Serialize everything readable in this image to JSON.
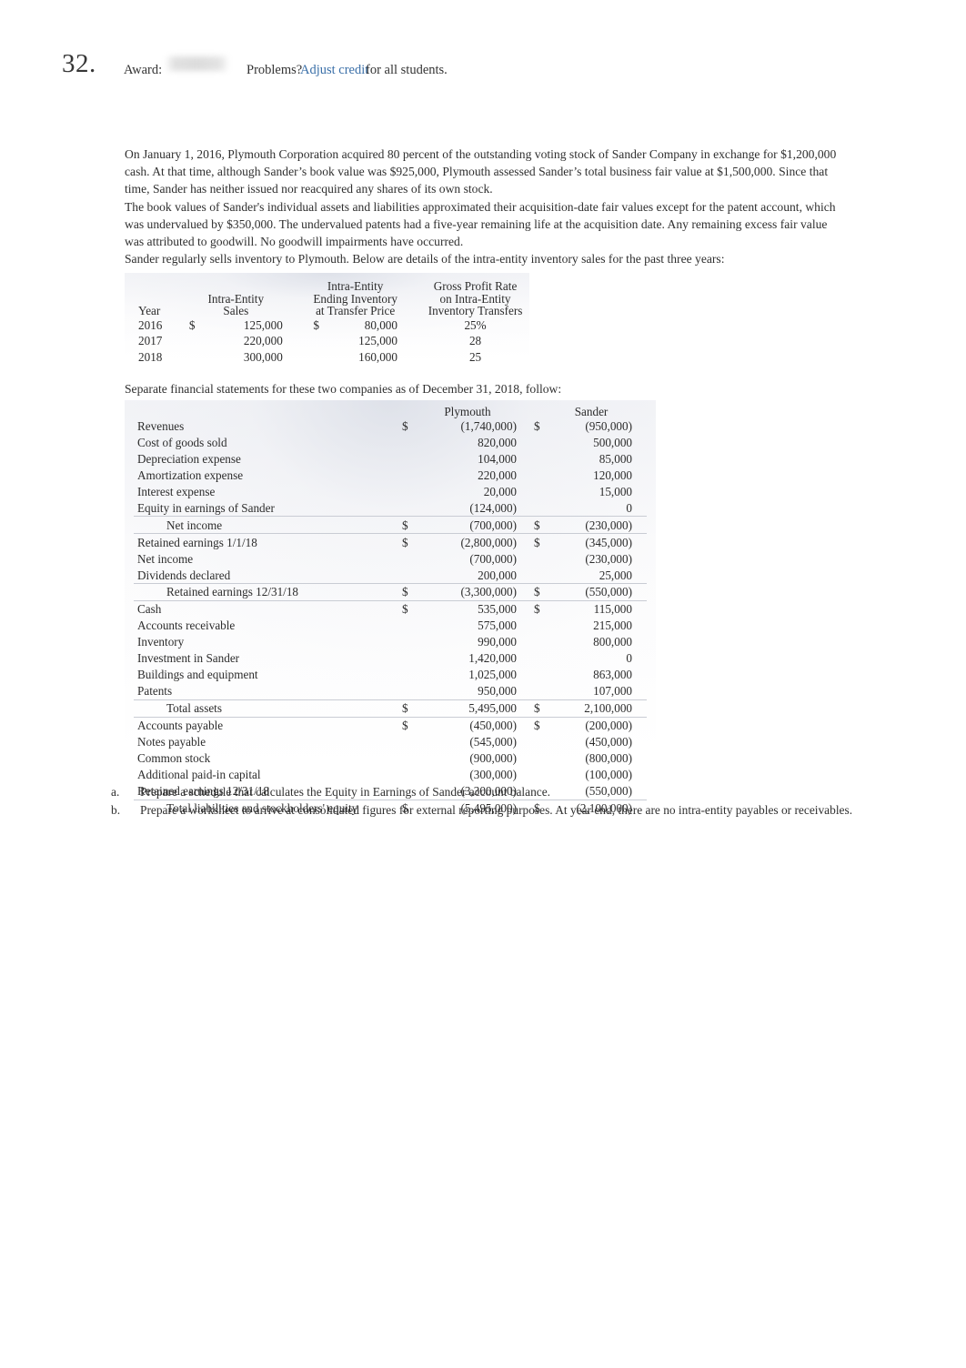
{
  "header": {
    "question_number": "32.",
    "award_label": "Award:",
    "award_value_hidden": "",
    "problems_label": "Problems?",
    "adjust_credit_link": "Adjust credit",
    "for_all_students": "for all students."
  },
  "body": {
    "paragraph_1": "On January 1, 2016, Plymouth Corporation acquired 80 percent of the outstanding voting stock of Sander Company in exchange for $1,200,000 cash. At that time, although Sander’s book value was $925,000, Plymouth assessed Sander’s total business fair value at $1,500,000. Since that time, Sander has neither issued nor reacquired any shares of its own stock.",
    "paragraph_2": "The book values of Sander's individual assets and liabilities approximated their acquisition-date fair values except for the patent account, which was undervalued by $350,000. The undervalued patents had a five-year remaining life at the acquisition date. Any remaining excess fair value was attributed to goodwill. No goodwill impairments have occurred.",
    "paragraph_3": "Sander regularly sells inventory to Plymouth. Below are details of the intra-entity inventory sales for the past three years:",
    "paragraph_4": "Separate financial statements for these two companies as of December 31, 2018, follow:"
  },
  "intra_entity_table": {
    "headers": {
      "col1_line3": "Year",
      "col2_line2": "Intra-Entity",
      "col2_line3": "Sales",
      "col3_line1": "Intra-Entity",
      "col3_line2": "Ending Inventory",
      "col3_line3": "at Transfer Price",
      "col4_line1": "Gross Profit Rate",
      "col4_line2": "on Intra-Entity",
      "col4_line3": "Inventory Transfers"
    },
    "rows": [
      {
        "year": "2016",
        "sales_cur": "$",
        "sales": "125,000",
        "ending_cur": "$",
        "ending": "80,000",
        "rate": "25%"
      },
      {
        "year": "2017",
        "sales_cur": "",
        "sales": "220,000",
        "ending_cur": "",
        "ending": "125,000",
        "rate": "28"
      },
      {
        "year": "2018",
        "sales_cur": "",
        "sales": "300,000",
        "ending_cur": "",
        "ending": "160,000",
        "rate": "25"
      }
    ]
  },
  "statements_table": {
    "col_header_plymouth": "Plymouth",
    "col_header_sander": "Sander",
    "rows": [
      {
        "label": "Revenues",
        "indent": false,
        "rule": false,
        "gap": false,
        "p_cur": "$",
        "p_amt": "(1,740,000)",
        "s_cur": "$",
        "s_amt": "(950,000)"
      },
      {
        "label": "Cost of goods sold",
        "indent": false,
        "rule": false,
        "gap": false,
        "p_cur": "",
        "p_amt": "820,000",
        "s_cur": "",
        "s_amt": "500,000"
      },
      {
        "label": "Depreciation expense",
        "indent": false,
        "rule": false,
        "gap": false,
        "p_cur": "",
        "p_amt": "104,000",
        "s_cur": "",
        "s_amt": "85,000"
      },
      {
        "label": "Amortization expense",
        "indent": false,
        "rule": false,
        "gap": false,
        "p_cur": "",
        "p_amt": "220,000",
        "s_cur": "",
        "s_amt": "120,000"
      },
      {
        "label": "Interest expense",
        "indent": false,
        "rule": false,
        "gap": false,
        "p_cur": "",
        "p_amt": "20,000",
        "s_cur": "",
        "s_amt": "15,000"
      },
      {
        "label": "Equity in earnings of Sander",
        "indent": false,
        "rule": false,
        "gap": false,
        "p_cur": "",
        "p_amt": "(124,000)",
        "s_cur": "",
        "s_amt": "0"
      },
      {
        "label": "Net income",
        "indent": true,
        "rule": true,
        "gap": false,
        "p_cur": "$",
        "p_amt": "(700,000)",
        "s_cur": "$",
        "s_amt": "(230,000)"
      },
      {
        "label": "Retained earnings 1/1/18",
        "indent": false,
        "rule": true,
        "gap": true,
        "p_cur": "$",
        "p_amt": "(2,800,000)",
        "s_cur": "$",
        "s_amt": "(345,000)"
      },
      {
        "label": "Net income",
        "indent": false,
        "rule": false,
        "gap": false,
        "p_cur": "",
        "p_amt": "(700,000)",
        "s_cur": "",
        "s_amt": "(230,000)"
      },
      {
        "label": "Dividends declared",
        "indent": false,
        "rule": false,
        "gap": false,
        "p_cur": "",
        "p_amt": "200,000",
        "s_cur": "",
        "s_amt": "25,000"
      },
      {
        "label": "Retained earnings 12/31/18",
        "indent": true,
        "rule": true,
        "gap": false,
        "p_cur": "$",
        "p_amt": "(3,300,000)",
        "s_cur": "$",
        "s_amt": "(550,000)"
      },
      {
        "label": "Cash",
        "indent": false,
        "rule": true,
        "gap": true,
        "p_cur": "$",
        "p_amt": "535,000",
        "s_cur": "$",
        "s_amt": "115,000"
      },
      {
        "label": "Accounts receivable",
        "indent": false,
        "rule": false,
        "gap": false,
        "p_cur": "",
        "p_amt": "575,000",
        "s_cur": "",
        "s_amt": "215,000"
      },
      {
        "label": "Inventory",
        "indent": false,
        "rule": false,
        "gap": false,
        "p_cur": "",
        "p_amt": "990,000",
        "s_cur": "",
        "s_amt": "800,000"
      },
      {
        "label": "Investment in Sander",
        "indent": false,
        "rule": false,
        "gap": false,
        "p_cur": "",
        "p_amt": "1,420,000",
        "s_cur": "",
        "s_amt": "0"
      },
      {
        "label": "Buildings and equipment",
        "indent": false,
        "rule": false,
        "gap": false,
        "p_cur": "",
        "p_amt": "1,025,000",
        "s_cur": "",
        "s_amt": "863,000"
      },
      {
        "label": "Patents",
        "indent": false,
        "rule": false,
        "gap": false,
        "p_cur": "",
        "p_amt": "950,000",
        "s_cur": "",
        "s_amt": "107,000"
      },
      {
        "label": "Total assets",
        "indent": true,
        "rule": true,
        "gap": false,
        "p_cur": "$",
        "p_amt": "5,495,000",
        "s_cur": "$",
        "s_amt": "2,100,000"
      },
      {
        "label": "Accounts payable",
        "indent": false,
        "rule": true,
        "gap": true,
        "p_cur": "$",
        "p_amt": "(450,000)",
        "s_cur": "$",
        "s_amt": "(200,000)"
      },
      {
        "label": "Notes payable",
        "indent": false,
        "rule": false,
        "gap": false,
        "p_cur": "",
        "p_amt": "(545,000)",
        "s_cur": "",
        "s_amt": "(450,000)"
      },
      {
        "label": "Common stock",
        "indent": false,
        "rule": false,
        "gap": false,
        "p_cur": "",
        "p_amt": "(900,000)",
        "s_cur": "",
        "s_amt": "(800,000)"
      },
      {
        "label": "Additional paid-in capital",
        "indent": false,
        "rule": false,
        "gap": false,
        "p_cur": "",
        "p_amt": "(300,000)",
        "s_cur": "",
        "s_amt": "(100,000)"
      },
      {
        "label": "Retained earnings 12/31/18",
        "indent": false,
        "rule": false,
        "gap": false,
        "p_cur": "",
        "p_amt": "(3,300,000)",
        "s_cur": "",
        "s_amt": "(550,000)"
      },
      {
        "label": "Total liabilities and stockholders' equity",
        "indent": true,
        "rule": true,
        "gap": false,
        "p_cur": "$",
        "p_amt": "(5,495,000)",
        "s_cur": "$",
        "s_amt": "(2,100,000)"
      }
    ]
  },
  "questions": [
    {
      "marker": "a.",
      "text": "Prepare a schedule that calculates the Equity in Earnings of Sander account balance."
    },
    {
      "marker": "b.",
      "text": "Prepare a worksheet to arrive at consolidated figures for external reporting purposes. At year end, there are no intra-entity payables or receivables."
    }
  ],
  "colors": {
    "link": "#3a6fa8",
    "text": "#2f2f2f",
    "table_rule": "#c9ccd4"
  }
}
